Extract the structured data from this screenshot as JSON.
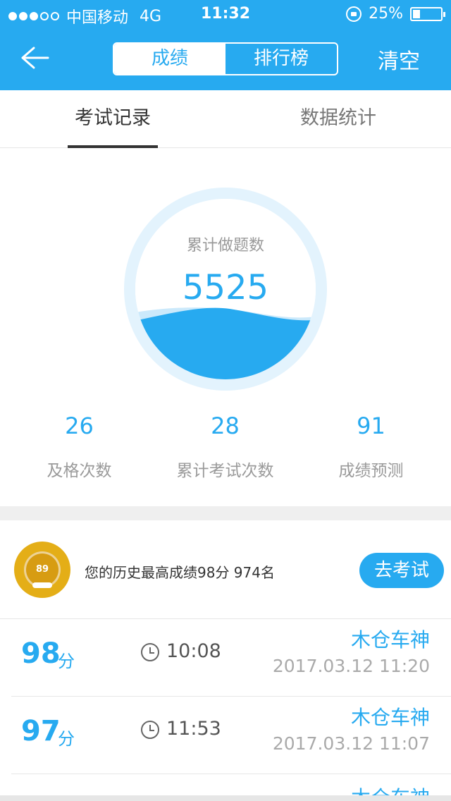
{
  "status_bar": {
    "signal_dots_filled": 3,
    "signal_dots_total": 5,
    "carrier": "中国移动",
    "network": "4G",
    "time": "11:32",
    "battery": "25%",
    "battery_level": 0.25
  },
  "header": {
    "back_icon": "arrow-left-icon",
    "segments": [
      "成绩",
      "排行榜"
    ],
    "active_segment": 0,
    "clear_label": "清空",
    "color": "#27aaf0"
  },
  "tabs": [
    {
      "label": "考试记录",
      "active": true
    },
    {
      "label": "数据统计",
      "active": false
    }
  ],
  "summary": {
    "total_label": "累计做题数",
    "total_value": "5525",
    "stats": [
      {
        "value": "26",
        "label": "及格次数"
      },
      {
        "value": "28",
        "label": "累计考试次数"
      },
      {
        "value": "91",
        "label": "成绩预测"
      }
    ]
  },
  "best": {
    "badge_score": "89",
    "text": "您的历史最高成绩98分  974名",
    "button_label": "去考试"
  },
  "records": [
    {
      "score": "98",
      "unit": "分",
      "duration": "10:08",
      "name": "木仓车神",
      "date": "2017.03.12 11:20"
    },
    {
      "score": "97",
      "unit": "分",
      "duration": "11:53",
      "name": "木仓车神",
      "date": "2017.03.12 11:07"
    },
    {
      "name": "木仓车神"
    }
  ]
}
